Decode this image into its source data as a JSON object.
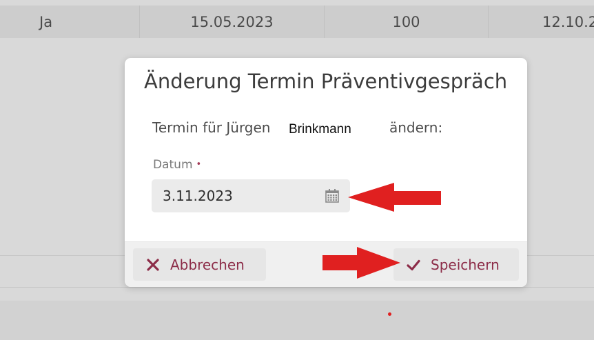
{
  "background_table": {
    "row": [
      "Ja",
      "15.05.2023",
      "100",
      "12.10.2"
    ]
  },
  "dialog": {
    "title": "Änderung Termin Präventivgespräch",
    "text_before": "Termin für Jürgen",
    "name": "Brinkmann",
    "text_after": "ändern:",
    "date_label": "Datum",
    "required_marker": "•",
    "date_value": "3.11.2023",
    "cancel_label": "Abbrechen",
    "save_label": "Speichern"
  },
  "icons": {
    "calendar": "calendar-icon",
    "cancel": "close-icon",
    "save": "checkmark-icon",
    "annotation_arrows": "red-arrow"
  },
  "colors": {
    "accent": "#8c2c48",
    "annotation": "#e02020"
  }
}
